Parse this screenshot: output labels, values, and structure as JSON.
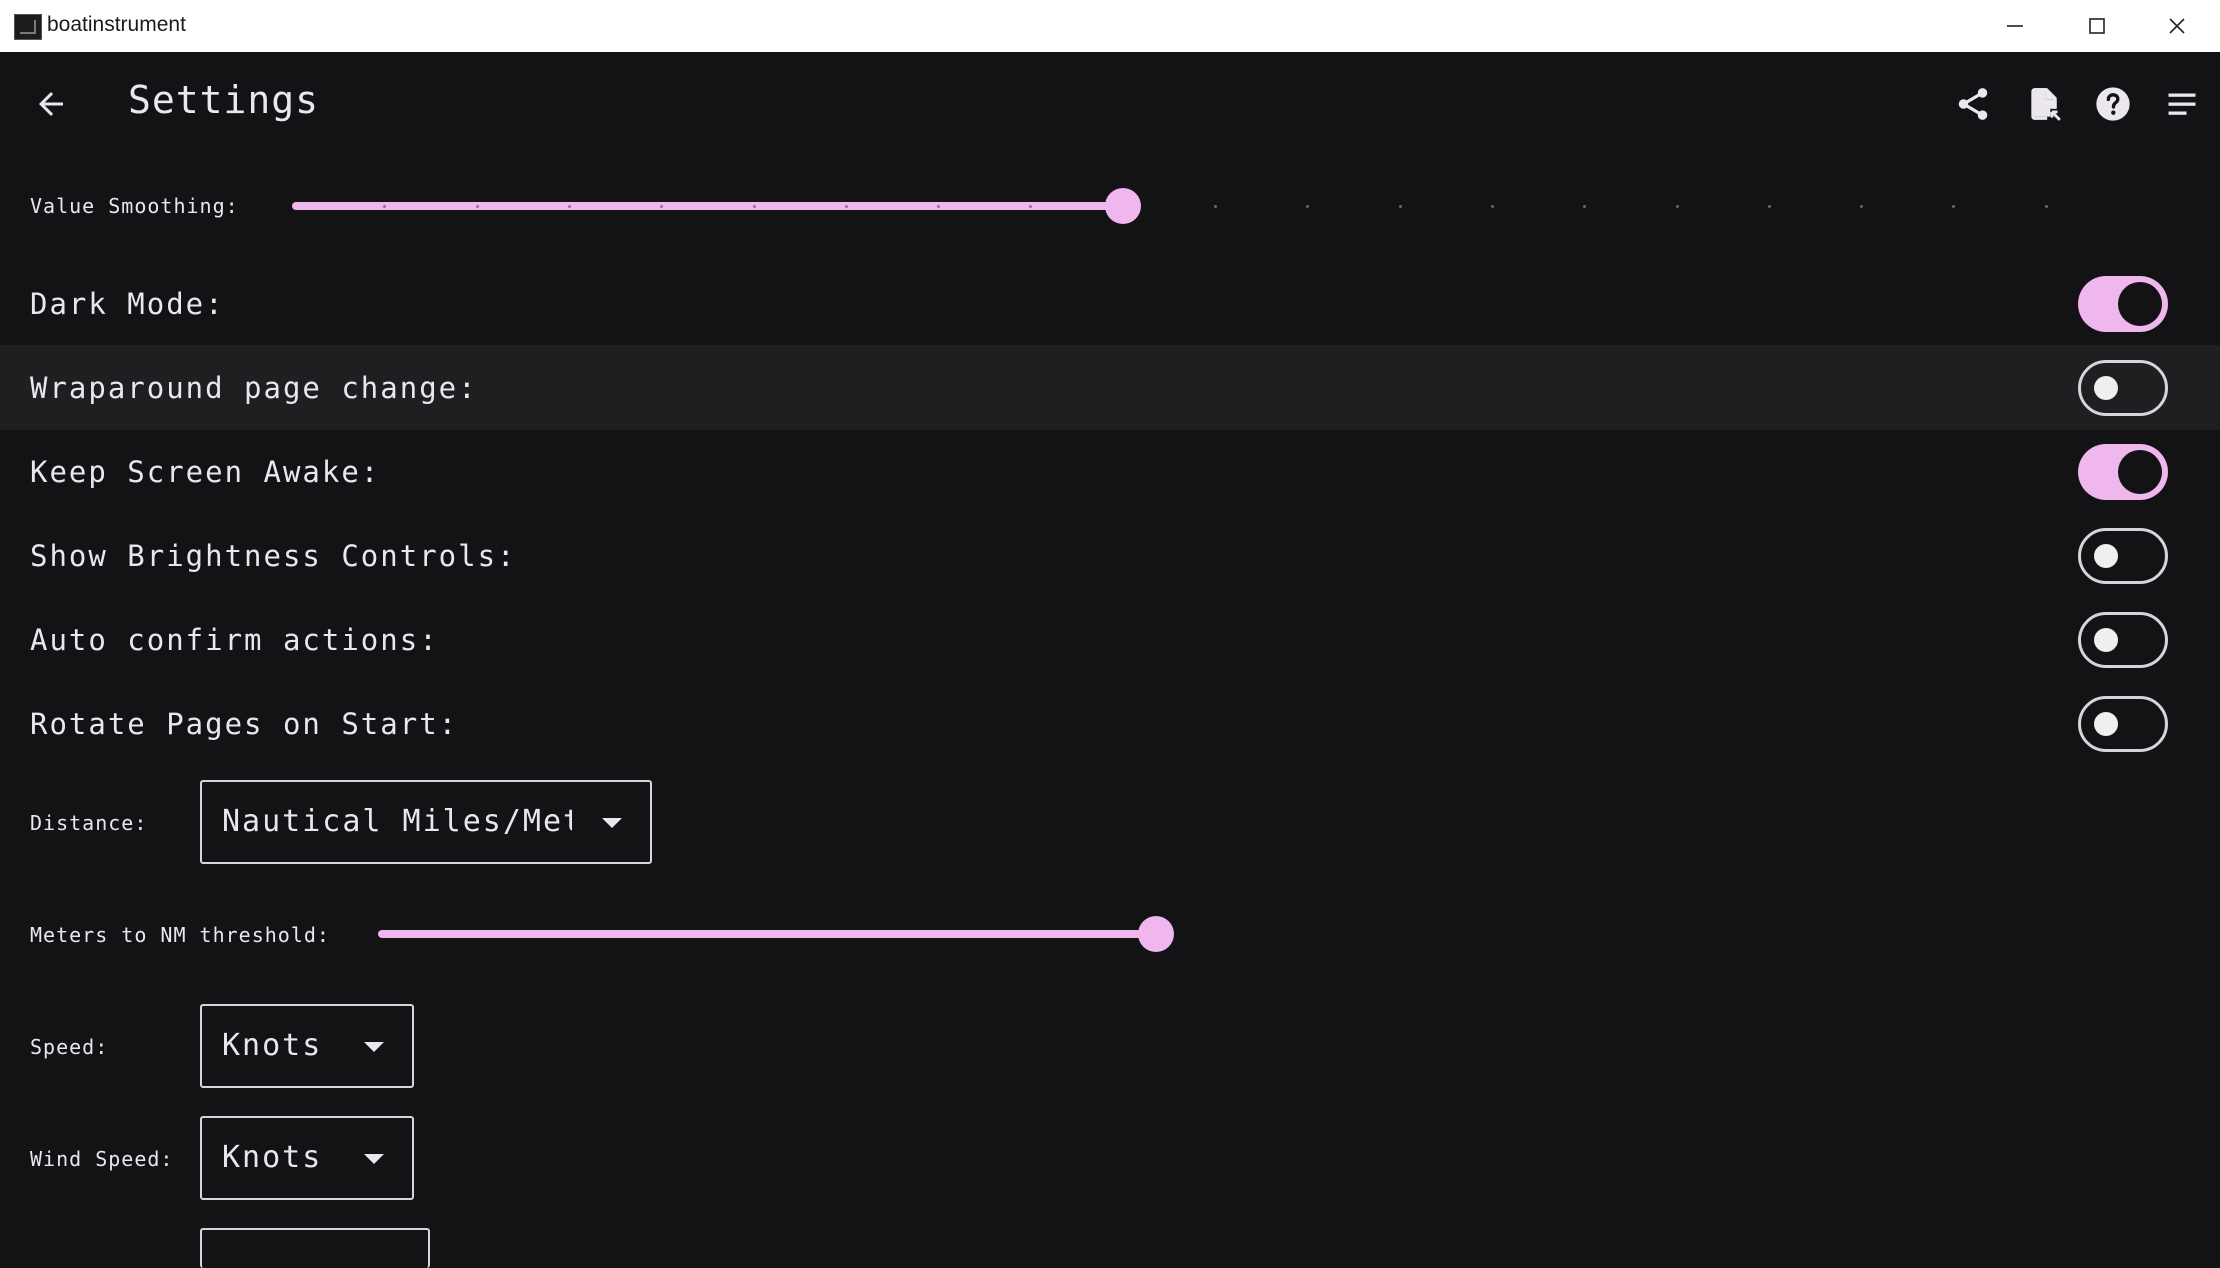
{
  "window": {
    "title": "boatinstrument"
  },
  "appbar": {
    "title": "Settings"
  },
  "icons": {
    "back": "arrow-left-icon",
    "share": "share-icon",
    "export": "file-export-icon",
    "help": "help-circle-icon",
    "menu": "menu-lines-icon"
  },
  "colors": {
    "accent": "#f0b6ee",
    "background": "#131214",
    "highlight_row": "#1f1e20"
  },
  "settings": {
    "value_smoothing": {
      "label": "Value Smoothing:",
      "value": 9,
      "max": 20
    },
    "toggles": [
      {
        "label": "Dark Mode:",
        "on": true
      },
      {
        "label": "Wraparound page change:",
        "on": false
      },
      {
        "label": "Keep Screen Awake:",
        "on": true
      },
      {
        "label": "Show Brightness Controls:",
        "on": false
      },
      {
        "label": "Auto confirm actions:",
        "on": false
      },
      {
        "label": "Rotate Pages on Start:",
        "on": false
      }
    ],
    "distance": {
      "label": "Distance:",
      "value": "Nautical Miles/Meters"
    },
    "meters_threshold": {
      "label": "Meters to NM threshold:",
      "fraction": 1.0
    },
    "speed": {
      "label": "Speed:",
      "value": "Knots"
    },
    "wind_speed": {
      "label": "Wind Speed:",
      "value": "Knots"
    }
  }
}
